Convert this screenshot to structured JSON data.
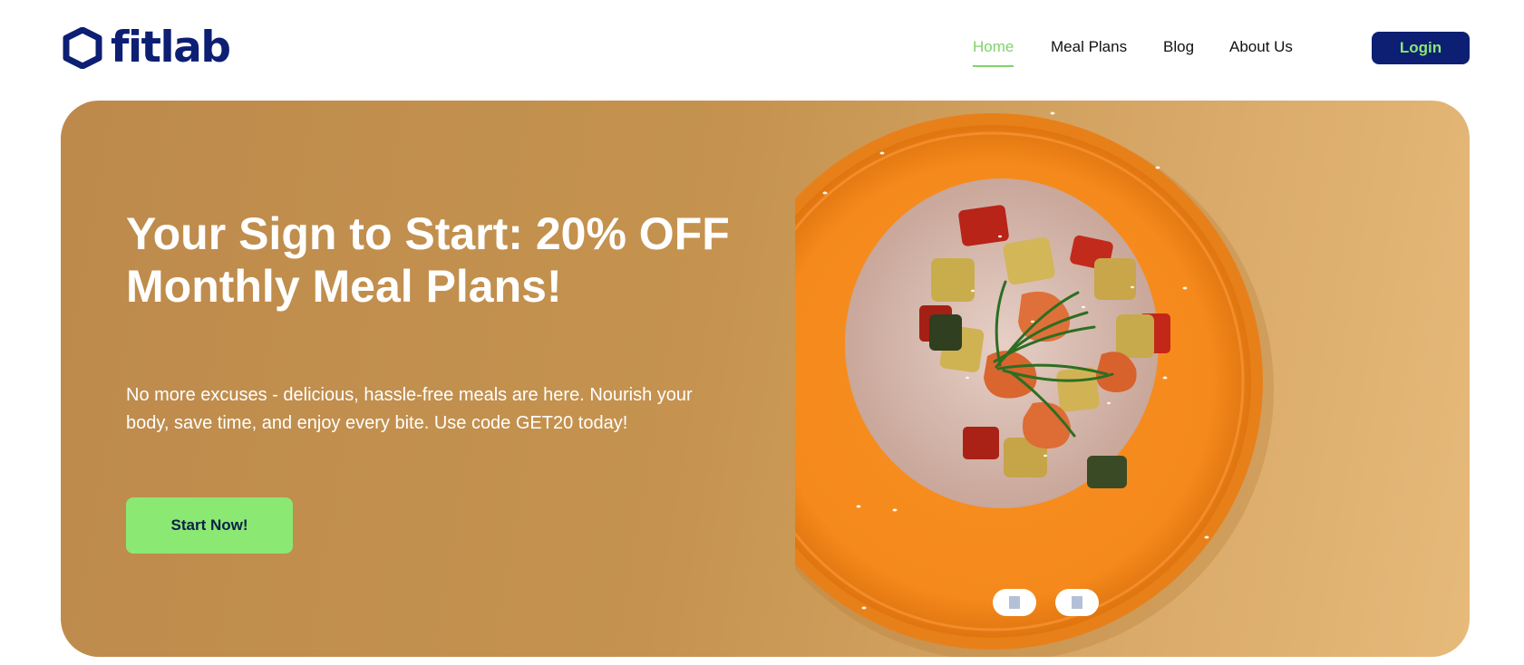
{
  "brand": {
    "name": "fitlab"
  },
  "nav": {
    "items": [
      {
        "label": "Home",
        "active": true
      },
      {
        "label": "Meal Plans",
        "active": false
      },
      {
        "label": "Blog",
        "active": false
      },
      {
        "label": "About Us",
        "active": false
      }
    ],
    "login_label": "Login"
  },
  "hero": {
    "headline": "Your Sign to Start: 20% OFF Monthly Meal Plans!",
    "subtext": "No more excuses - delicious, hassle-free meals are here. Nourish your body, save time, and enjoy every bite. Use code GET20 today!",
    "cta_label": "Start Now!",
    "carousel": {
      "slide_count": 2
    }
  },
  "colors": {
    "brand_navy": "#0d1f73",
    "accent_green": "#8ae873",
    "active_nav_green": "#7fd36a",
    "hero_tan": "#c5934f",
    "plate_orange": "#f58a1f"
  },
  "icons": {
    "logo": "hexagon-logo-icon",
    "hero_image": "rice-shrimp-plate-image"
  }
}
